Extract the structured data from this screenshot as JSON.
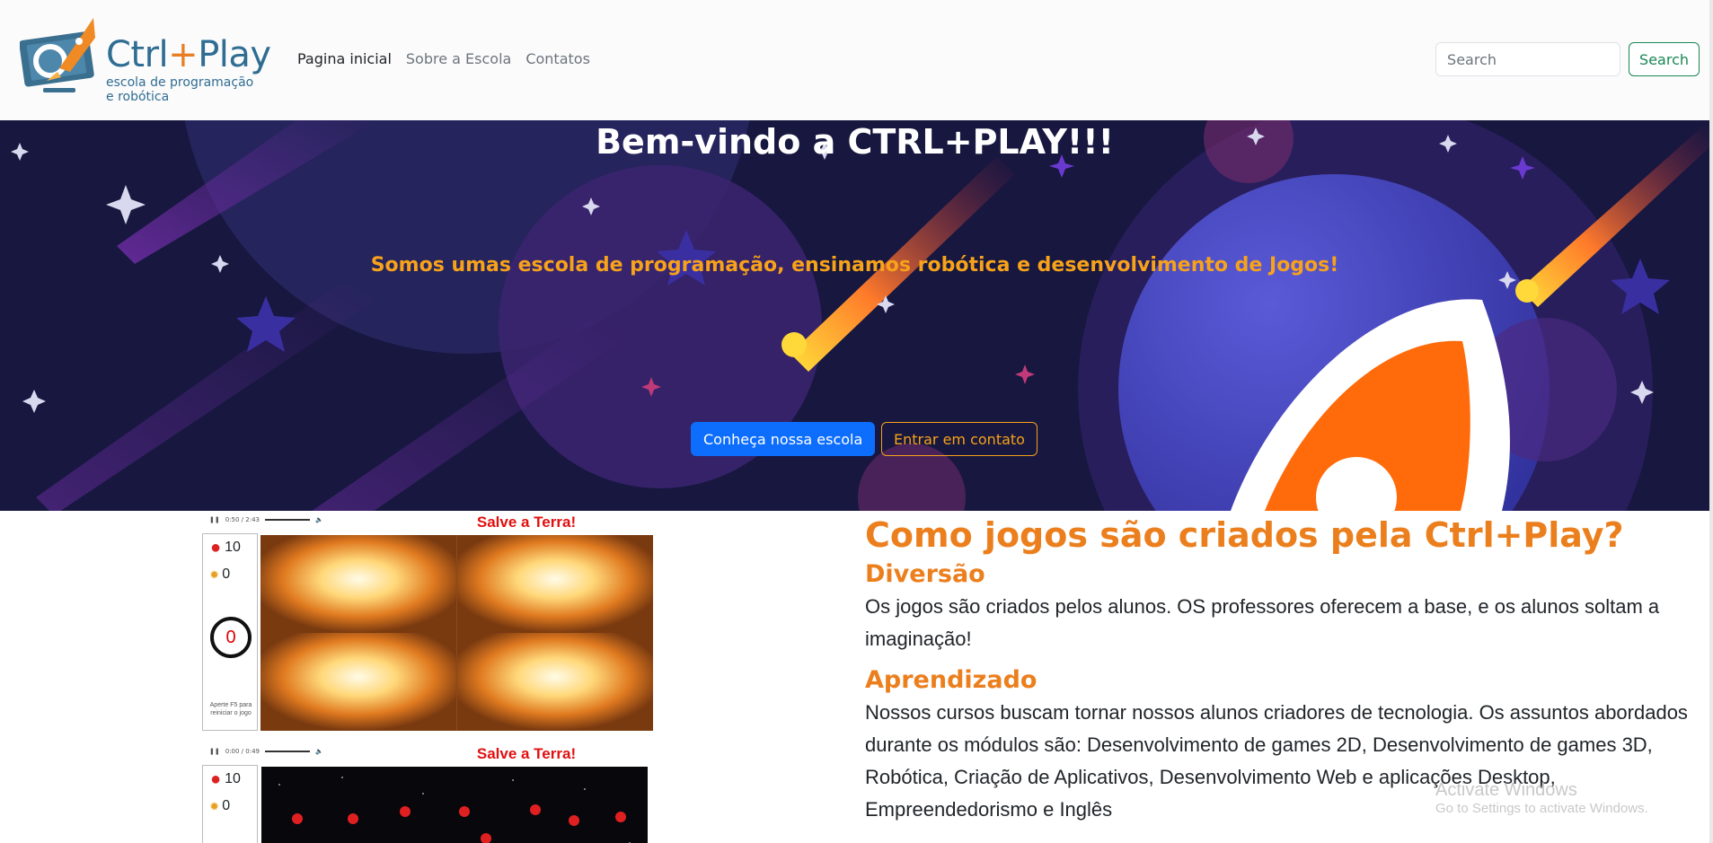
{
  "logo": {
    "title_main": "Ctrl",
    "title_plus": "+",
    "title_end": "Play",
    "subtitle_line1": "escola de programação",
    "subtitle_line2": "e robótica"
  },
  "nav": {
    "items": [
      {
        "label": "Pagina inicial"
      },
      {
        "label": "Sobre a Escola"
      },
      {
        "label": "Contatos"
      }
    ]
  },
  "search": {
    "placeholder": "Search",
    "button_label": "Search"
  },
  "hero": {
    "title": "Bem-vindo a CTRL+PLAY!!!",
    "subtitle": "Somos umas escola de programação, ensinamos robótica e desenvolvimento de Jogos!",
    "button_primary": "Conheça nossa escola",
    "button_secondary": "Entrar em contato"
  },
  "games": [
    {
      "title": "Salve a Terra!",
      "audio_time": "0:50 / 2:43",
      "lives": "10",
      "boom": "0",
      "timer": "0",
      "hint": "Aperte F5 para reiniciar o jogo"
    },
    {
      "title": "Salve a Terra!",
      "audio_time": "0:00 / 0:49",
      "lives": "10",
      "boom": "0"
    }
  ],
  "content": {
    "title": "Como jogos são criados pela Ctrl+Play?",
    "section1_heading": "Diversão",
    "section1_text": "Os jogos são criados pelos alunos. OS professores oferecem a base, e os alunos soltam a imaginação!",
    "section2_heading": "Aprendizado",
    "section2_text": "Nossos cursos buscam tornar nossos alunos criadores de tecnologia. Os assuntos abordados durante os módulos são: Desenvolvimento de games 2D, Desenvolvimento de games 3D, Robótica, Criação de Aplicativos, Desenvolvimento Web e aplicações Desktop, Empreendedorismo e Inglês"
  },
  "watermark": {
    "line1": "Activate Windows",
    "line2": "Go to Settings to activate Windows."
  },
  "colors": {
    "brand_orange": "#ec7f1d",
    "hero_bg": "#17173f",
    "primary_blue": "#0d6efd",
    "success_green": "#198754"
  }
}
